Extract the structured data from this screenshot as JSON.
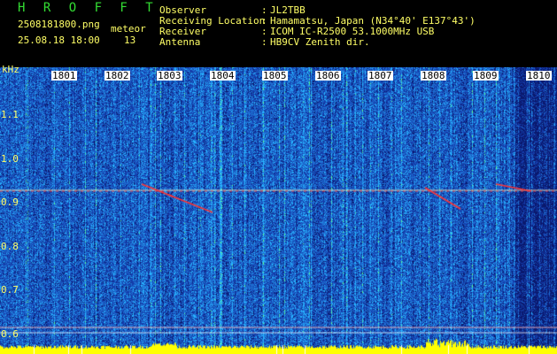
{
  "header": {
    "app_title": "H R O F F T",
    "filename": "2508181800.png",
    "datetime": "25.08.18 18:00",
    "meteor_label": "meteor",
    "meteor_count": "13"
  },
  "station": [
    {
      "label": "Observer",
      "value": "JL2TBB"
    },
    {
      "label": "Receiving Location",
      "value": "Hamamatsu, Japan (N34°40' E137°43')"
    },
    {
      "label": "Receiver",
      "value": "ICOM IC-R2500 53.1000MHz USB"
    },
    {
      "label": "Antenna",
      "value": "HB9CV Zenith dir."
    }
  ],
  "chart_data": {
    "type": "heatmap",
    "ylabel": "kHz",
    "y_ticks": [
      "1.1",
      "1.0",
      "0.9",
      "0.8",
      "0.7",
      "0.6"
    ],
    "x_ticks": [
      "1801",
      "1802",
      "1803",
      "1804",
      "1805",
      "1806",
      "1807",
      "1808",
      "1809",
      "1810"
    ],
    "ylim": [
      0.58,
      1.18
    ],
    "carrier_khz": 0.92,
    "colors": {
      "background": "#1a3fa0",
      "noise_hi": "#33c0ff",
      "noise_peak": "#66ff99",
      "signal": "#ff3333",
      "floor": "#ffff00"
    }
  }
}
